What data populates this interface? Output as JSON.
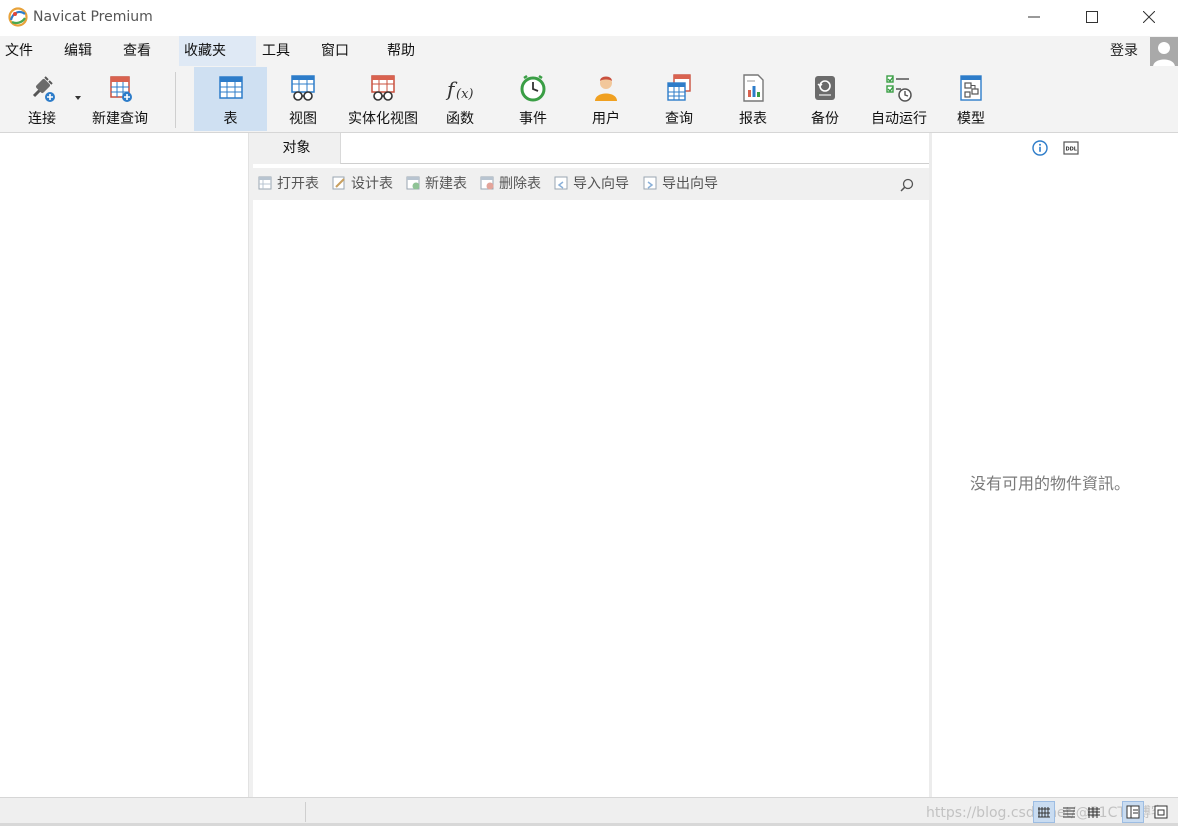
{
  "window": {
    "title": "Navicat Premium",
    "logo_icon": "navicat-logo-icon",
    "controls": [
      "minimize-icon",
      "maximize-icon",
      "close-icon"
    ]
  },
  "menu": {
    "items": [
      "文件",
      "编辑",
      "查看",
      "收藏夹",
      "工具",
      "窗口",
      "帮助"
    ],
    "active_item": "收藏夹",
    "login_label": "登录",
    "avatar_icon": "user-avatar-icon"
  },
  "toolbar": {
    "buttons": [
      {
        "label": "连接",
        "icon": "connection-plug-icon",
        "has_dropdown": true
      },
      {
        "label": "新建查询",
        "icon": "new-query-icon"
      },
      {
        "label": "表",
        "icon": "table-icon",
        "active": true
      },
      {
        "label": "视图",
        "icon": "view-glasses-icon"
      },
      {
        "label": "实体化视图",
        "icon": "materialized-view-icon"
      },
      {
        "label": "函数",
        "icon": "function-fx-icon"
      },
      {
        "label": "事件",
        "icon": "event-clock-icon"
      },
      {
        "label": "用户",
        "icon": "user-icon"
      },
      {
        "label": "查询",
        "icon": "query-icon"
      },
      {
        "label": "报表",
        "icon": "report-icon"
      },
      {
        "label": "备份",
        "icon": "backup-icon"
      },
      {
        "label": "自动运行",
        "icon": "automation-icon"
      },
      {
        "label": "模型",
        "icon": "model-icon"
      }
    ]
  },
  "object_panel": {
    "tab_label": "对象",
    "actions": [
      {
        "label": "打开表",
        "icon": "open-table-icon"
      },
      {
        "label": "设计表",
        "icon": "design-table-icon"
      },
      {
        "label": "新建表",
        "icon": "new-table-icon"
      },
      {
        "label": "删除表",
        "icon": "delete-table-icon"
      },
      {
        "label": "导入向导",
        "icon": "import-wizard-icon"
      },
      {
        "label": "导出向导",
        "icon": "export-wizard-icon"
      }
    ],
    "search_icon": "search-icon"
  },
  "info_panel": {
    "icons": [
      "info-icon",
      "ddl-icon"
    ],
    "empty_message": "没有可用的物件資訊。"
  },
  "statusbar": {
    "watermark": "https://blog.csdn.net/@51CTO博客",
    "view_modes": [
      "grid-view-icon",
      "list-view-icon",
      "detail-view-icon",
      "info-pane-icon",
      "preview-pane-icon"
    ]
  },
  "colors": {
    "active_toolbar_bg": "#cfe0f2",
    "menu_active_bg": "#dfe9f5",
    "accent_blue": "#2d7cc9"
  }
}
